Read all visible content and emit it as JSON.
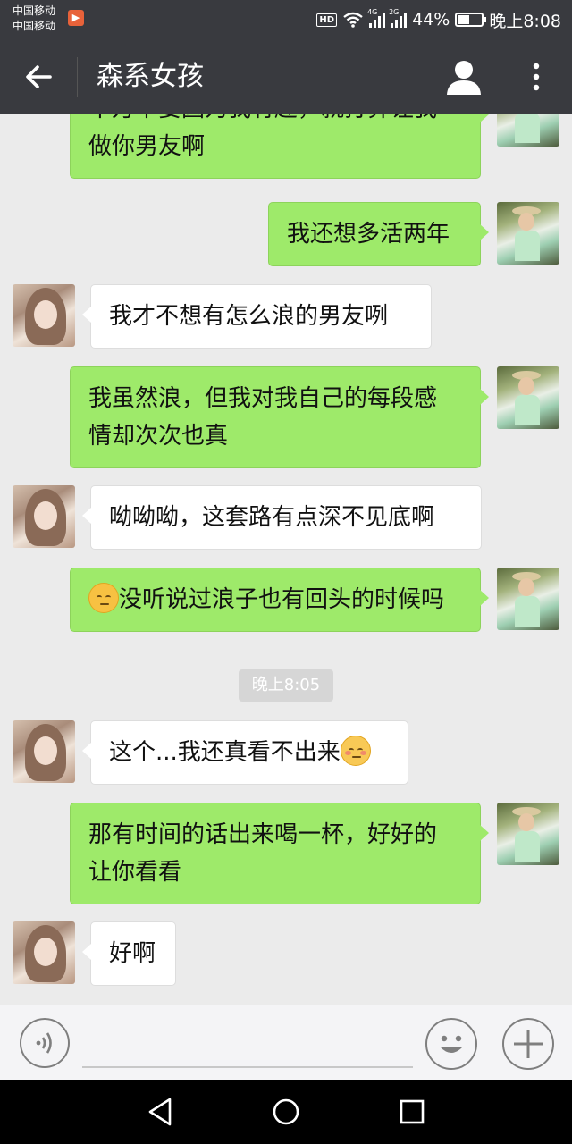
{
  "status_bar": {
    "carrier_1": "中国移动",
    "carrier_2": "中国移动",
    "hd": "HD",
    "network_1": "4G",
    "network_2": "2G",
    "battery_level": 0.44,
    "battery_text": "44%",
    "time": "晚上8:08"
  },
  "header": {
    "title": "森系女孩",
    "back_icon": "arrow-left-icon",
    "profile_icon": "person-icon",
    "more_icon": "more-vertical-icon"
  },
  "messages": [
    {
      "side": "me",
      "text_line1": "千万不要因为我有趣，就打算让我",
      "text_line2": "做你男友啊"
    },
    {
      "side": "me",
      "text": "我还想多活两年"
    },
    {
      "side": "her",
      "text": "我才不想有怎么浪的男友咧"
    },
    {
      "side": "me",
      "text_line1": "我虽然浪，但我对我自己的每段感",
      "text_line2": "情却次次也真"
    },
    {
      "side": "her",
      "text": "呦呦呦，这套路有点深不见底啊"
    },
    {
      "side": "me",
      "emoji": "pensive-face-emoji",
      "text": "没听说过浪子也有回头的时候吗"
    },
    {
      "side": "her",
      "text": "这个...我还真看不出来",
      "emoji": "blushing-face-emoji"
    },
    {
      "side": "me",
      "text_line1": "那有时间的话出来喝一杯，好好的",
      "text_line2": "让你看看"
    },
    {
      "side": "her",
      "text": "好啊"
    }
  ],
  "timestamp": "晚上8:05",
  "input_bar": {
    "voice_icon": "voice-icon",
    "emoji_icon": "smiley-icon",
    "plus_icon": "plus-icon",
    "input_value": ""
  },
  "nav_bar": {
    "back_icon": "nav-back-icon",
    "home_icon": "nav-home-icon",
    "recent_icon": "nav-recent-apps-icon"
  }
}
